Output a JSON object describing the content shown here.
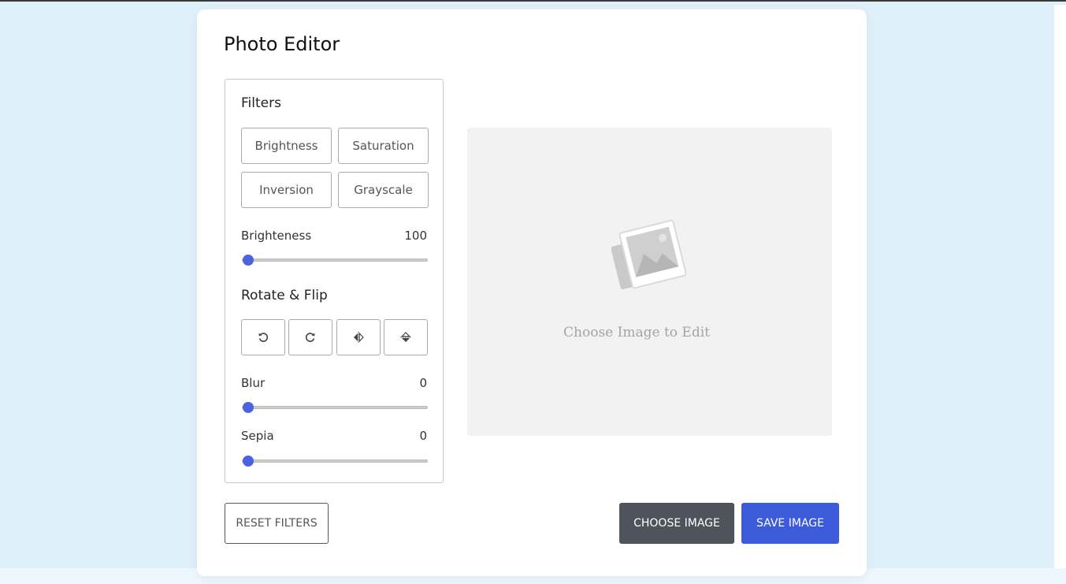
{
  "app": {
    "title": "Photo Editor"
  },
  "filters": {
    "heading": "Filters",
    "buttons": [
      "Brightness",
      "Saturation",
      "Inversion",
      "Grayscale"
    ],
    "active_slider": {
      "label": "Brighteness",
      "value": "100",
      "fraction": 0
    }
  },
  "rotate_flip": {
    "heading": "Rotate & Flip",
    "buttons": [
      {
        "icon": "rotate-left-icon"
      },
      {
        "icon": "rotate-right-icon"
      },
      {
        "icon": "flip-horizontal-icon"
      },
      {
        "icon": "flip-vertical-icon"
      }
    ]
  },
  "sliders": {
    "blur": {
      "label": "Blur",
      "value": "0",
      "fraction": 0
    },
    "sepia": {
      "label": "Sepia",
      "value": "0",
      "fraction": 0
    }
  },
  "preview": {
    "placeholder_text": "Choose Image to Edit",
    "icon": "image-placeholder-icon"
  },
  "actions": {
    "reset_label": "RESET FILTERS",
    "choose_label": "CHOOSE IMAGE",
    "save_label": "SAVE IMAGE"
  },
  "colors": {
    "accent": "#3b5bdb",
    "choose_button": "#4f545c",
    "background": "#e0f0fb"
  }
}
